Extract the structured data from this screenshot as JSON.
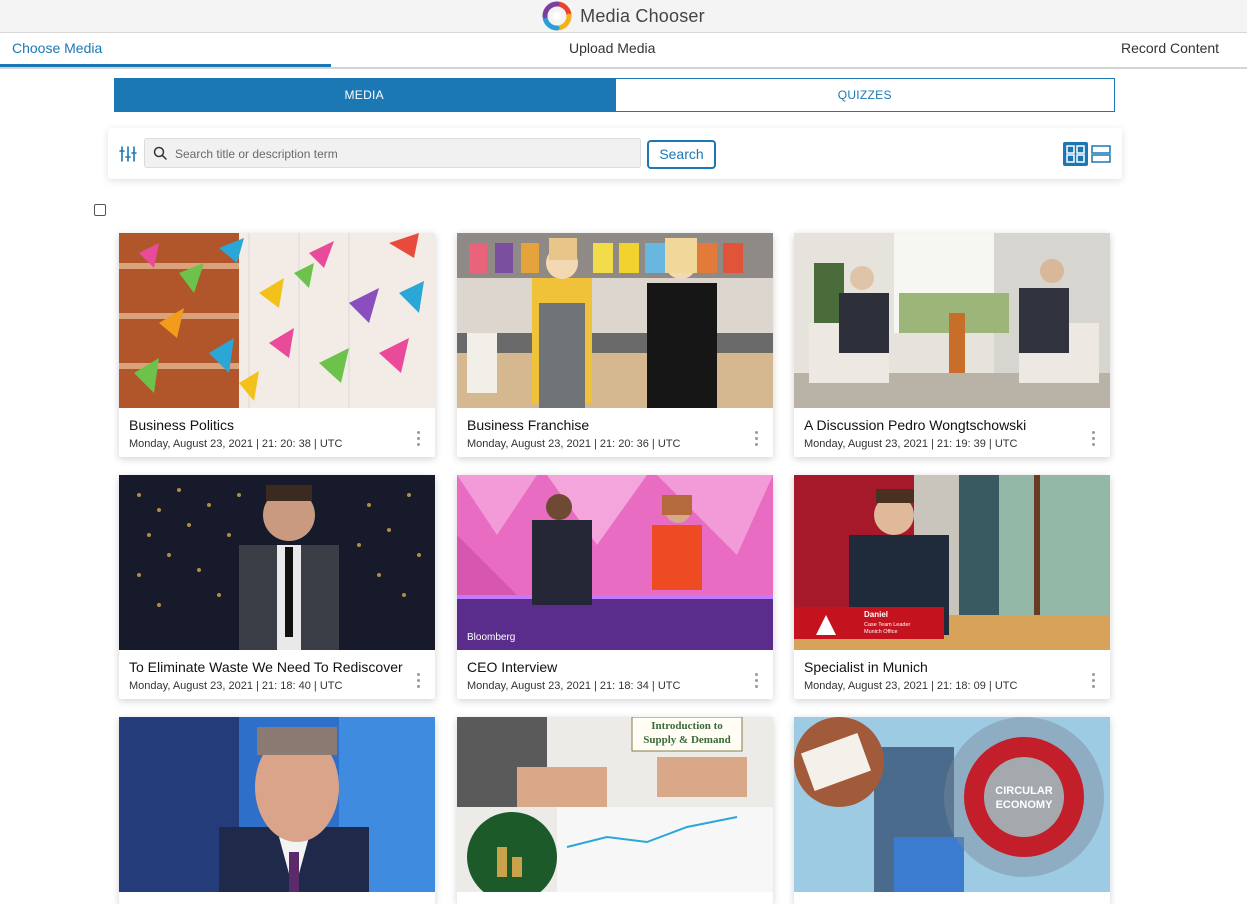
{
  "app": {
    "title": "Media Chooser"
  },
  "nav_tabs": [
    {
      "label": "Choose Media",
      "active": true
    },
    {
      "label": "Upload Media",
      "active": false
    },
    {
      "label": "Record Content",
      "active": false
    }
  ],
  "segments": [
    {
      "label": "MEDIA",
      "active": true
    },
    {
      "label": "QUIZZES",
      "active": false
    }
  ],
  "search": {
    "placeholder": "Search title or description term",
    "value": "",
    "button_label": "Search"
  },
  "colors": {
    "accent": "#1b78b4"
  },
  "media_items": [
    {
      "title": "Business Politics",
      "date": "Monday, August 23, 2021 | 21: 20: 38 | UTC"
    },
    {
      "title": "Business Franchise",
      "date": "Monday, August 23, 2021 | 21: 20: 36 | UTC"
    },
    {
      "title": "A Discussion Pedro Wongtschowski",
      "date": "Monday, August 23, 2021 | 21: 19: 39 | UTC"
    },
    {
      "title": "To Eliminate Waste We Need To Rediscover",
      "date": "Monday, August 23, 2021 | 21: 18: 40 | UTC"
    },
    {
      "title": "CEO Interview",
      "date": "Monday, August 23, 2021 | 21: 18: 34 | UTC"
    },
    {
      "title": "Specialist in Munich",
      "date": "Monday, August 23, 2021 | 21: 18: 09 | UTC"
    }
  ],
  "thumb_text": {
    "bloomberg": "Bloomberg",
    "name_tag_name": "Daniel",
    "name_tag_role": "Case Team Leader",
    "name_tag_office": "Munich Office",
    "supply_line1": "Introduction to",
    "supply_line2": "Supply & Demand",
    "circular_line1": "CIRCULAR",
    "circular_line2": "ECONOMY"
  }
}
